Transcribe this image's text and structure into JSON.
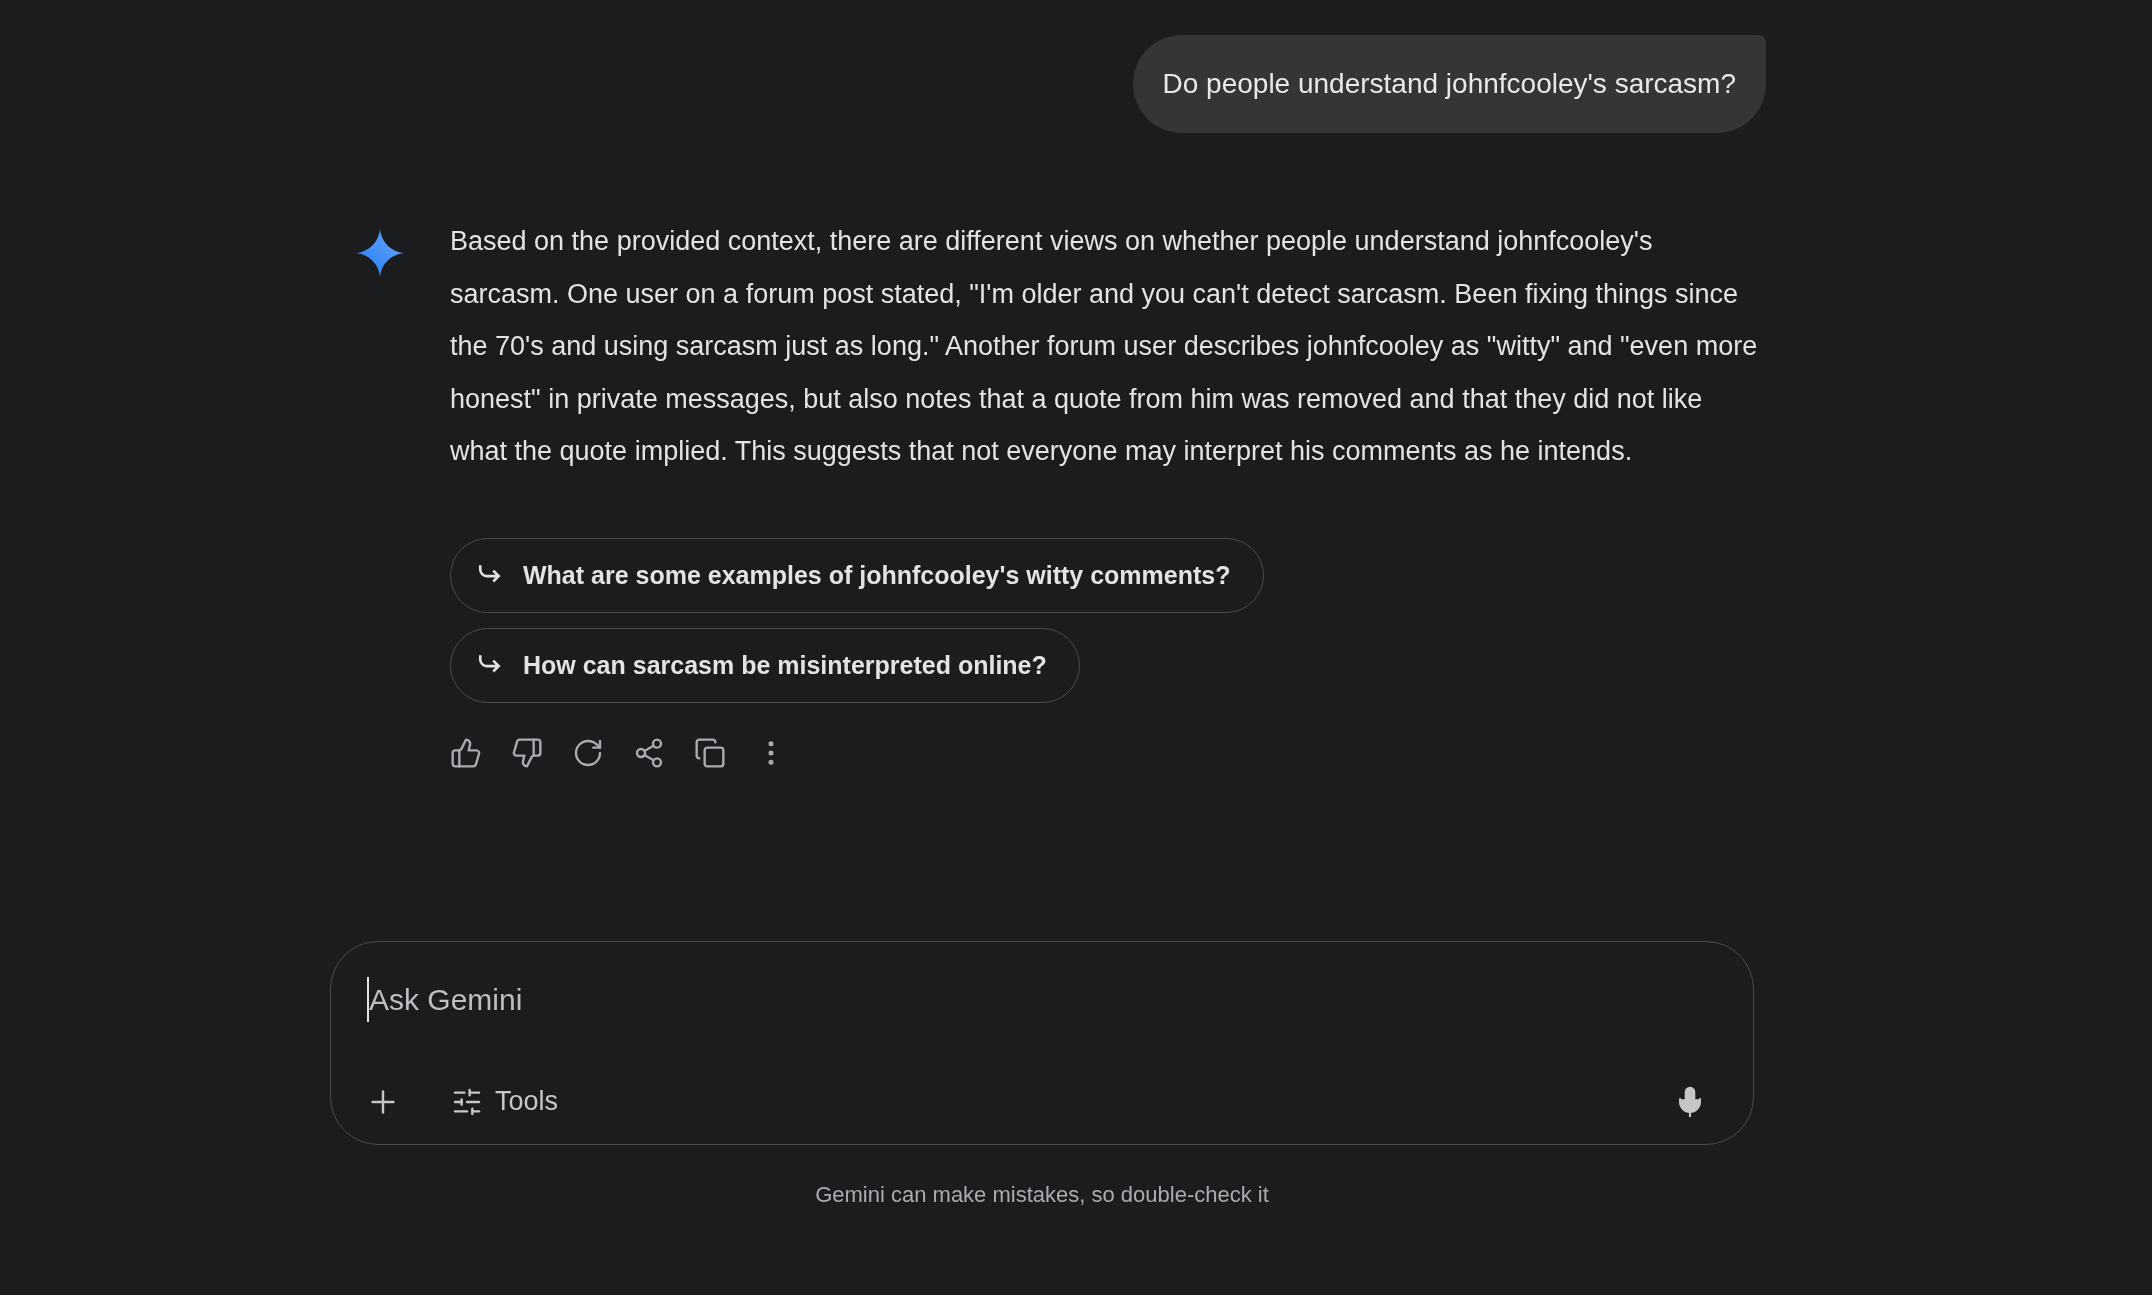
{
  "user_message": "Do people understand johnfcooley's sarcasm?",
  "response": {
    "text": "Based on the provided context, there are different views on whether people understand johnfcooley's sarcasm. One user on a forum post stated, \"I'm older and you can't detect sarcasm. Been fixing things since the 70's and using sarcasm just as long.\" Another forum user describes johnfcooley as \"witty\" and \"even more honest\" in private messages, but also notes that a quote from him was removed and that they did not like what the quote implied. This suggests that not everyone may interpret his comments as he intends.",
    "suggestions": [
      "What are some examples of johnfcooley's witty comments?",
      "How can sarcasm be misinterpreted online?"
    ]
  },
  "input": {
    "placeholder": "Ask Gemini",
    "tools_label": "Tools"
  },
  "footer": "Gemini can make mistakes, so double-check it"
}
